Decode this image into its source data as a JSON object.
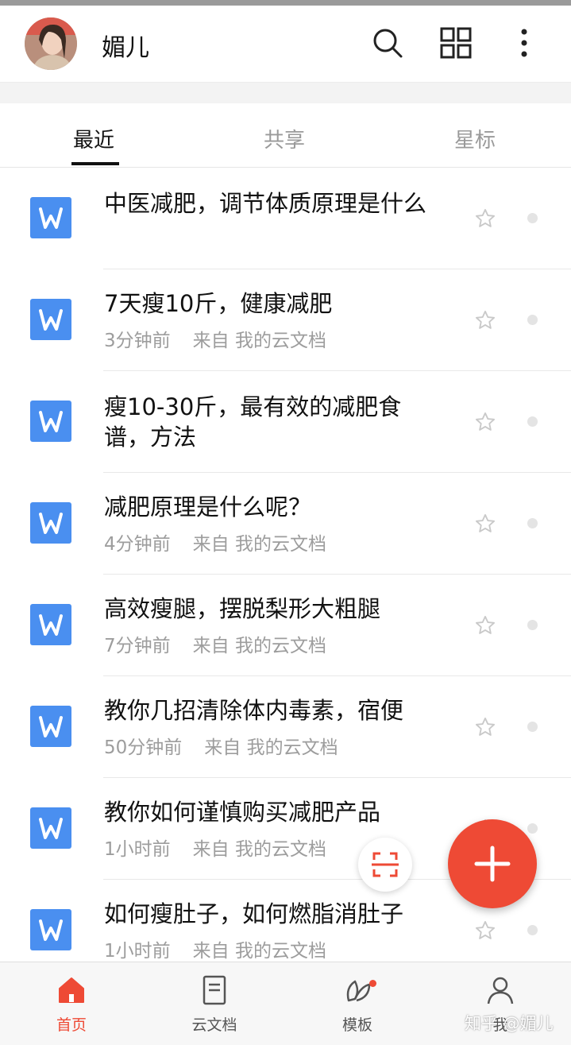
{
  "header": {
    "username": "媚儿"
  },
  "tabs": [
    {
      "label": "最近"
    },
    {
      "label": "共享"
    },
    {
      "label": "星标"
    }
  ],
  "documents": [
    {
      "title": "中医减肥，调节体质原理是什么",
      "time": "",
      "source": ""
    },
    {
      "title": "7天瘦10斤，健康减肥",
      "time": "3分钟前",
      "source": "来自 我的云文档"
    },
    {
      "title": "瘦10-30斤，最有效的减肥食谱，方法",
      "time": "",
      "source": ""
    },
    {
      "title": "减肥原理是什么呢？",
      "time": "4分钟前",
      "source": "来自 我的云文档"
    },
    {
      "title": "高效瘦腿，摆脱梨形大粗腿",
      "time": "7分钟前",
      "source": "来自 我的云文档"
    },
    {
      "title": "教你几招清除体内毒素，宿便",
      "time": "50分钟前",
      "source": "来自 我的云文档"
    },
    {
      "title": "教你如何谨慎购买减肥产品",
      "time": "1小时前",
      "source": "来自 我的云文档"
    },
    {
      "title": "如何瘦肚子，如何燃脂消肚子",
      "time": "1小时前",
      "source": "来自 我的云文档"
    }
  ],
  "bottom_nav": [
    {
      "label": "首页"
    },
    {
      "label": "云文档"
    },
    {
      "label": "模板"
    },
    {
      "label": "我"
    }
  ],
  "watermark": "知乎 @媚儿",
  "colors": {
    "accent": "#ee4a35",
    "doc_icon": "#4a8ff0"
  }
}
